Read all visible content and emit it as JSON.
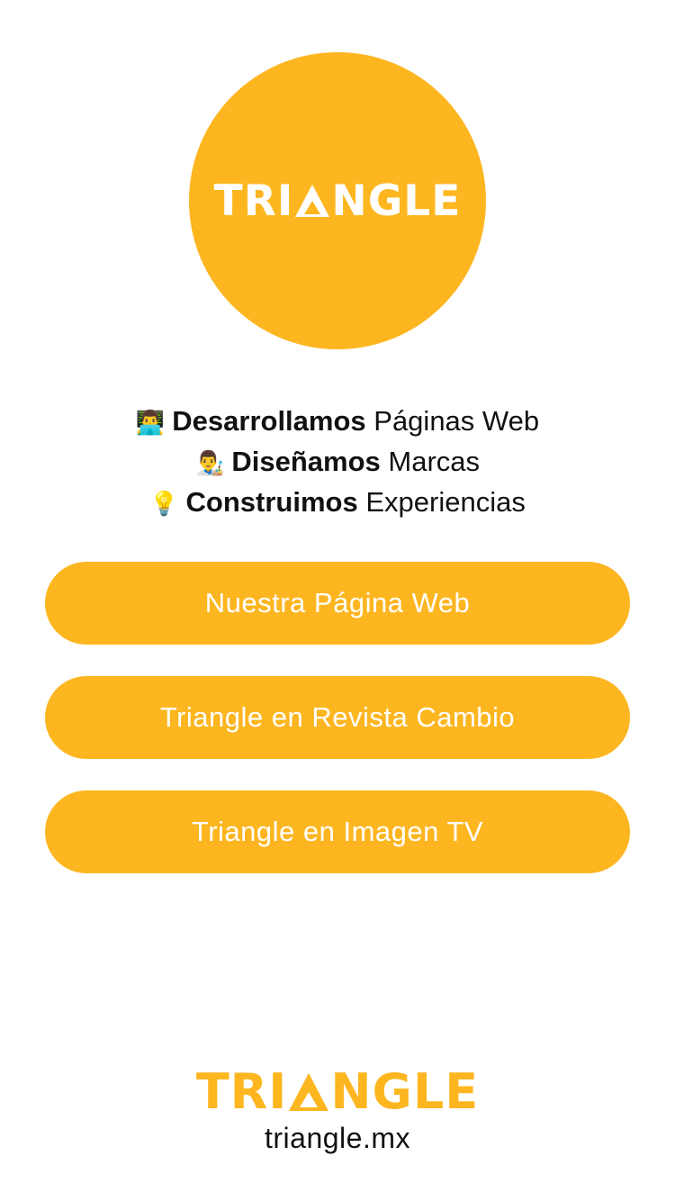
{
  "profile": {
    "logo_left": "TRI",
    "logo_right": "NGLE",
    "logo_full": "TRIANGLE",
    "brand_color": "#FDB620"
  },
  "tagline": [
    {
      "emoji": "👨‍💻",
      "strong": "Desarrollamos",
      "rest": " Páginas Web"
    },
    {
      "emoji": "👨‍🎨",
      "strong": "Diseñamos",
      "rest": " Marcas"
    },
    {
      "emoji": "💡",
      "strong": "Construimos",
      "rest": " Experiencias"
    }
  ],
  "links": [
    {
      "label": "Nuestra Página Web"
    },
    {
      "label": "Triangle en Revista Cambio"
    },
    {
      "label": "Triangle en Imagen TV"
    }
  ],
  "footer": {
    "logo_left": "TRI",
    "logo_right": "NGLE",
    "domain": "triangle.mx"
  }
}
